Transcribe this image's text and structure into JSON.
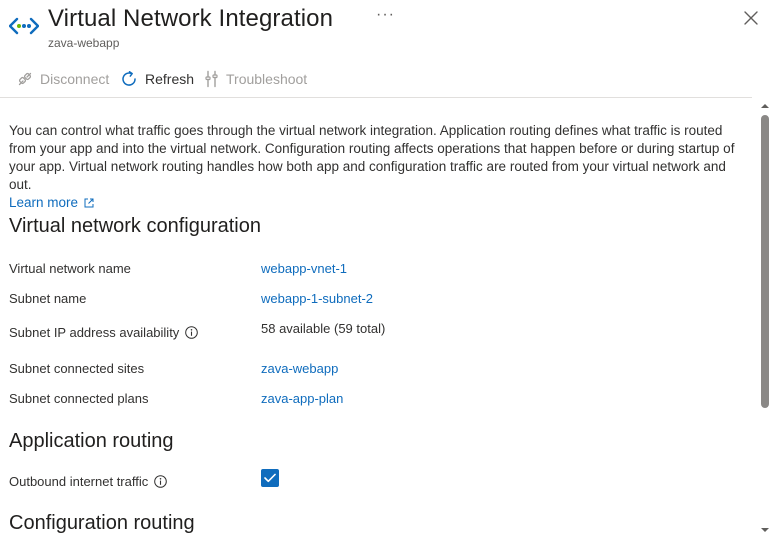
{
  "header": {
    "title": "Virtual Network Integration",
    "subtitle": "zava-webapp",
    "more_label": "···",
    "icon": "vnet-integration-icon",
    "close_icon": "close-icon"
  },
  "toolbar": {
    "disconnect_label": "Disconnect",
    "refresh_label": "Refresh",
    "troubleshoot_label": "Troubleshoot"
  },
  "intro": {
    "text": "You can control what traffic goes through the virtual network integration. Application routing defines what traffic is routed from your app and into the virtual network. Configuration routing affects operations that happen before or during startup of your app. Virtual network routing handles how both app and configuration traffic are routed from your virtual network and out.",
    "learn_more": "Learn more"
  },
  "vnet_config": {
    "title": "Virtual network configuration",
    "rows": [
      {
        "label": "Virtual network name",
        "value": "webapp-vnet-1"
      },
      {
        "label": "Subnet name",
        "value": "webapp-1-subnet-2"
      },
      {
        "label": "Subnet IP address availability",
        "value": "58 available (59 total)"
      },
      {
        "label": "Subnet connected sites",
        "value": "zava-webapp"
      },
      {
        "label": "Subnet connected plans",
        "value": "zava-app-plan"
      }
    ]
  },
  "app_routing": {
    "title": "Application routing",
    "outbound_label": "Outbound internet traffic",
    "outbound_checked": true
  },
  "config_routing": {
    "title": "Configuration routing"
  },
  "colors": {
    "accent": "#0f6cbd",
    "disabled": "#a19f9d",
    "text": "#323130"
  }
}
